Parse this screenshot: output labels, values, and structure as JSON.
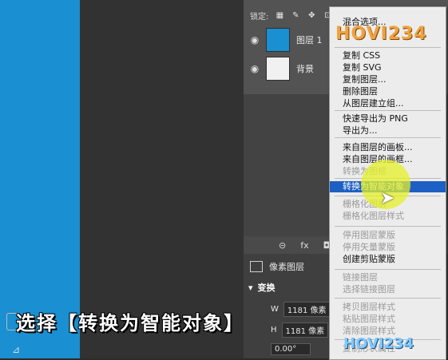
{
  "lock_bar": {
    "label": "锁定:"
  },
  "layers": [
    {
      "name": "图层 1",
      "thumb_color": "#1a8fd1"
    },
    {
      "name": "背景",
      "thumb_color": "#f1f1f1"
    }
  ],
  "panel_footer": {
    "fx_label": "fx"
  },
  "properties": {
    "header": "像素图层",
    "section": "变换",
    "width_label": "W",
    "width_value": "1181 像素",
    "height_label": "H",
    "height_value": "1181 像素",
    "angle_value": "0.00°"
  },
  "context_menu": {
    "items": [
      {
        "label": "混合选项...",
        "disabled": false
      },
      {
        "label": "复制 CSS",
        "disabled": false
      },
      {
        "label": "复制 SVG",
        "disabled": false
      },
      {
        "label": "复制图层...",
        "disabled": false
      },
      {
        "label": "删除图层",
        "disabled": false
      },
      {
        "label": "从图层建立组...",
        "disabled": false
      },
      {
        "label": "快速导出为 PNG",
        "disabled": false
      },
      {
        "label": "导出为...",
        "disabled": false
      },
      {
        "label": "来自图层的画板...",
        "disabled": false
      },
      {
        "label": "来自图层的画框...",
        "disabled": false
      },
      {
        "label": "转换为图框",
        "disabled": true
      },
      {
        "label": "转换为智能对象",
        "disabled": false,
        "highlight": true
      },
      {
        "label": "栅格化图层",
        "disabled": true
      },
      {
        "label": "栅格化图层样式",
        "disabled": true
      },
      {
        "label": "停用图层蒙版",
        "disabled": true
      },
      {
        "label": "停用矢量蒙版",
        "disabled": true
      },
      {
        "label": "创建剪贴蒙版",
        "disabled": false
      },
      {
        "label": "链接图层",
        "disabled": true
      },
      {
        "label": "选择链接图层",
        "disabled": true
      },
      {
        "label": "拷贝图层样式",
        "disabled": true
      },
      {
        "label": "粘贴图层样式",
        "disabled": true
      },
      {
        "label": "清除图层样式",
        "disabled": true
      },
      {
        "label": "复制形状属性",
        "disabled": true
      }
    ]
  },
  "watermark": {
    "top": "HOVI234",
    "bottom": "HOVI234"
  },
  "caption": "选择【转换为智能对象】",
  "colors": {
    "accent": "#1a8fd1",
    "highlight": "#1e5fc4",
    "cursor_glow": "#e6f028"
  }
}
